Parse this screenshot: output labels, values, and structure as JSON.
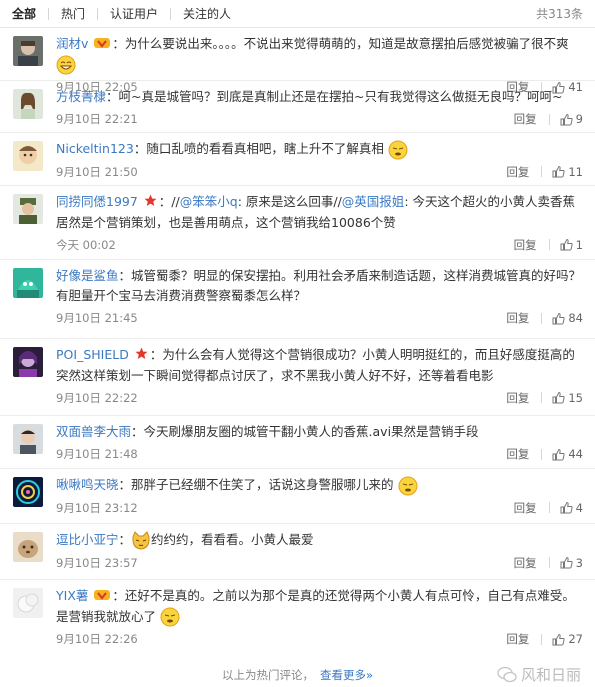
{
  "tabs": [
    {
      "label": "全部"
    },
    {
      "label": "热门"
    },
    {
      "label": "认证用户"
    },
    {
      "label": "关注的人"
    }
  ],
  "total_label": "共313条",
  "comments": [
    {
      "user": "润材v",
      "sep": "：",
      "text": "为什么要说出来。。。。不说出来觉得萌萌的，知道是故意摆拍后感觉被骗了很不爽",
      "time": "9月10日 22:05",
      "likes": "41"
    },
    {
      "user": "方枝菁棣",
      "sep": "：",
      "text": "呵~真是城管吗？到底是真制止还是在摆拍~只有我觉得这么做挺无良吗？呵呵~",
      "time": "9月10日 22:21",
      "likes": "9"
    },
    {
      "user": "Nickeltin123",
      "sep": "：",
      "text": "随口乱喷的看看真相吧，瞎上升不了解真相",
      "time": "9月10日 21:50",
      "likes": "11"
    },
    {
      "user": "同捞同僁1997",
      "sep": "：",
      "pre": "//",
      "mention1": "@笨笨小q",
      "mid": ": 原来是这么回事//",
      "mention2": "@英国报姐",
      "text": ": 今天这个超火的小黄人卖香蕉居然是个营销策划，也是善用萌点，这个营销我给10086个赞",
      "time": "今天 00:02",
      "likes": "1"
    },
    {
      "user": "好像是鲨鱼",
      "sep": "：",
      "text": "城管蜀黍？明显的保安摆拍。利用社会矛盾来制造话题，这样消费城管真的好吗？有胆量开个宝马去消费消费警察蜀黍怎么样？",
      "time": "9月10日 21:45",
      "likes": "84"
    },
    {
      "user": "POI_SHIELD",
      "sep": "：",
      "text": "为什么会有人觉得这个营销很成功？小黄人明明挺红的，而且好感度挺高的突然这样策划一下瞬间觉得都点讨厌了，求不黑我小黄人好不好，还等着看电影",
      "time": "9月10日 22:22",
      "likes": "15"
    },
    {
      "user": "双面兽李大雨",
      "sep": "：",
      "text": "今天刷爆朋友圈的城管干翻小黄人的香蕉.avi果然是营销手段",
      "time": "9月10日 21:48",
      "likes": "44"
    },
    {
      "user": "啾啾鸣天晓",
      "sep": "：",
      "text": "那胖子已经绷不住笑了，话说这身警服哪儿来的",
      "time": "9月10日 23:12",
      "likes": "4"
    },
    {
      "user": "逗比小亚宁",
      "sep": "：",
      "text": "约约约，看看看。小黄人最爱",
      "time": "9月10日 23:57",
      "likes": "3"
    },
    {
      "user": "YIX薯",
      "sep": "：",
      "text": "还好不是真的。之前以为那个是真的还觉得两个小黄人有点可怜，自己有点难受。是营销我就放心了",
      "time": "9月10日 22:26",
      "likes": "27"
    }
  ],
  "actions": {
    "reply": "回复"
  },
  "footer": {
    "text": "以上为热门评论，",
    "more": "查看更多»"
  },
  "watermark": "风和日丽",
  "colors": {
    "link": "#3b79c3",
    "meta": "#888888"
  }
}
